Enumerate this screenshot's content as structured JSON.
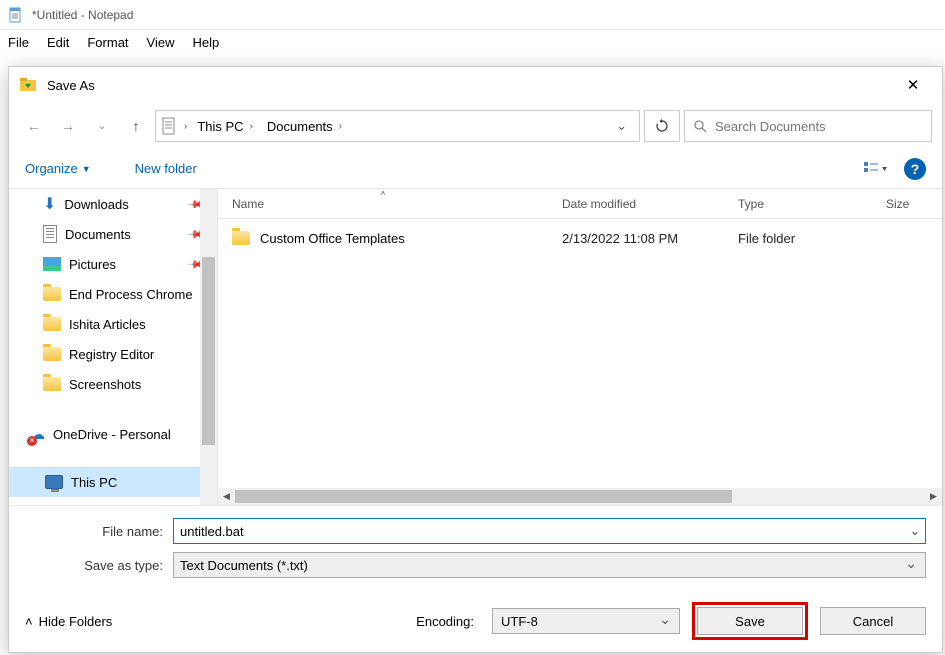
{
  "notepad": {
    "title": "*Untitled - Notepad",
    "menu": [
      "File",
      "Edit",
      "Format",
      "View",
      "Help"
    ]
  },
  "dialog": {
    "title": "Save As",
    "breadcrumbs": [
      "This PC",
      "Documents"
    ],
    "search_placeholder": "Search Documents",
    "toolbar": {
      "organize": "Organize",
      "newfolder": "New folder"
    },
    "nav": {
      "items": [
        {
          "label": "Downloads",
          "icon": "download",
          "pinned": true
        },
        {
          "label": "Documents",
          "icon": "document",
          "pinned": true
        },
        {
          "label": "Pictures",
          "icon": "pictures",
          "pinned": true
        },
        {
          "label": "End Process Chrome",
          "icon": "folder"
        },
        {
          "label": "Ishita Articles",
          "icon": "folder"
        },
        {
          "label": "Registry Editor",
          "icon": "folder"
        },
        {
          "label": "Screenshots",
          "icon": "folder"
        },
        {
          "label": "OneDrive - Personal",
          "icon": "onedrive",
          "error": true,
          "spaced": true
        },
        {
          "label": "This PC",
          "icon": "thispc",
          "selected": true,
          "spaced": true
        }
      ]
    },
    "filelist": {
      "columns": {
        "name": "Name",
        "date": "Date modified",
        "type": "Type",
        "size": "Size"
      },
      "rows": [
        {
          "name": "Custom Office Templates",
          "date": "2/13/2022 11:08 PM",
          "type": "File folder"
        }
      ]
    },
    "form": {
      "filename_label": "File name:",
      "filename_value": "untitled.bat",
      "filetype_label": "Save as type:",
      "filetype_value": "Text Documents (*.txt)",
      "encoding_label": "Encoding:",
      "encoding_value": "UTF-8",
      "hide_folders": "Hide Folders",
      "save": "Save",
      "cancel": "Cancel"
    }
  }
}
